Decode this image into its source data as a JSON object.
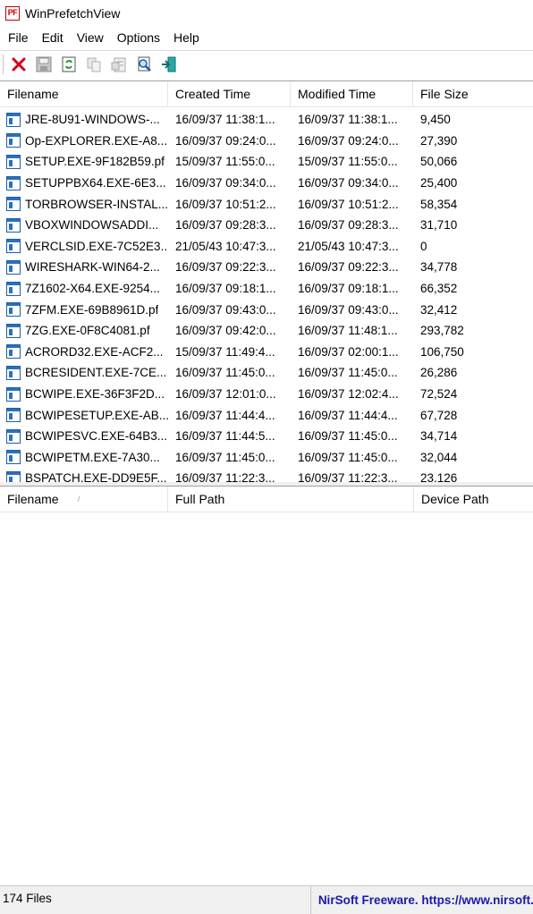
{
  "window": {
    "title": "WinPrefetchView",
    "icon_text": "PF"
  },
  "menu": [
    "File",
    "Edit",
    "View",
    "Options",
    "Help"
  ],
  "toolbar": {
    "buttons": [
      "delete-icon",
      "save-icon",
      "refresh-icon",
      "copy-icon",
      "properties-icon",
      "find-icon",
      "exit-icon"
    ]
  },
  "upper_table": {
    "columns": [
      "Filename",
      "Created Time",
      "Modified Time",
      "File Size"
    ],
    "rows": [
      [
        "JRE-8U91-WINDOWS-...",
        "16/09/37 11:38:1...",
        "16/09/37 11:38:1...",
        "9,450"
      ],
      [
        "Op-EXPLORER.EXE-A8...",
        "16/09/37 09:24:0...",
        "16/09/37 09:24:0...",
        "27,390"
      ],
      [
        "SETUP.EXE-9F182B59.pf",
        "15/09/37 11:55:0...",
        "15/09/37 11:55:0...",
        "50,066"
      ],
      [
        "SETUPPBX64.EXE-6E3...",
        "16/09/37 09:34:0...",
        "16/09/37 09:34:0...",
        "25,400"
      ],
      [
        "TORBROWSER-INSTAL...",
        "16/09/37 10:51:2...",
        "16/09/37 10:51:2...",
        "58,354"
      ],
      [
        "VBOXWINDOWSADDI...",
        "16/09/37 09:28:3...",
        "16/09/37 09:28:3...",
        "31,710"
      ],
      [
        "VERCLSID.EXE-7C52E3...",
        "21/05/43 10:47:3...",
        "21/05/43 10:47:3...",
        "0"
      ],
      [
        "WIRESHARK-WIN64-2...",
        "16/09/37 09:22:3...",
        "16/09/37 09:22:3...",
        "34,778"
      ],
      [
        "7Z1602-X64.EXE-9254...",
        "16/09/37 09:18:1...",
        "16/09/37 09:18:1...",
        "66,352"
      ],
      [
        "7ZFM.EXE-69B8961D.pf",
        "16/09/37 09:43:0...",
        "16/09/37 09:43:0...",
        "32,412"
      ],
      [
        "7ZG.EXE-0F8C4081.pf",
        "16/09/37 09:42:0...",
        "16/09/37 11:48:1...",
        "293,782"
      ],
      [
        "ACRORD32.EXE-ACF2...",
        "15/09/37 11:49:4...",
        "16/09/37 02:00:1...",
        "106,750"
      ],
      [
        "BCRESIDENT.EXE-7CE...",
        "16/09/37 11:45:0...",
        "16/09/37 11:45:0...",
        "26,286"
      ],
      [
        "BCWIPE.EXE-36F3F2D...",
        "16/09/37 12:01:0...",
        "16/09/37 12:02:4...",
        "72,524"
      ],
      [
        "BCWIPESETUP.EXE-AB...",
        "16/09/37 11:44:4...",
        "16/09/37 11:44:4...",
        "67,728"
      ],
      [
        "BCWIPESVC.EXE-64B3...",
        "16/09/37 11:44:5...",
        "16/09/37 11:45:0...",
        "34,714"
      ],
      [
        "BCWIPETM.EXE-7A30...",
        "16/09/37 11:45:0...",
        "16/09/37 11:45:0...",
        "32,044"
      ],
      [
        "BSPATCH.EXE-DD9E5F...",
        "16/09/37 11:22:3...",
        "16/09/37 11:22:3...",
        "23,126"
      ]
    ]
  },
  "lower_table": {
    "columns": [
      "Filename",
      "Full Path",
      "Device Path"
    ],
    "sort_indicator": "/"
  },
  "status": {
    "count": "174 Files",
    "link": "NirSoft Freeware. https://www.nirsoft.net"
  }
}
